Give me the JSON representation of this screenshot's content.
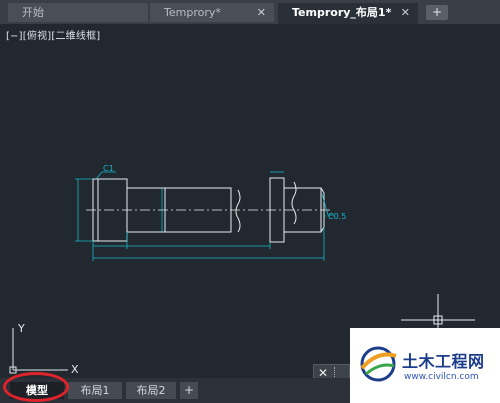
{
  "tabs": {
    "start_label": "开始",
    "tab1_label": "Temprory*",
    "tab2_label": "Temprory_布局1*",
    "close_glyph": "✕",
    "add_glyph": "+"
  },
  "viewport": {
    "label": "[−][俯视][二维线框]"
  },
  "drawing": {
    "dim_c1": "C1",
    "dim_c05": "C0.5"
  },
  "ucs": {
    "y_label": "Y",
    "x_label": "X"
  },
  "mini_panel": {
    "close_glyph": "✕"
  },
  "layout_tabs": {
    "model_label": "模型",
    "layout1_label": "布局1",
    "layout2_label": "布局2",
    "add_glyph": "+"
  },
  "watermark": {
    "title": "土木工程网",
    "url": "www.civilcn.com"
  },
  "colors": {
    "canvas": "#212830",
    "geometry": "#e9ecef",
    "dimension": "#18b7c8",
    "highlight": "#e0232b",
    "brand_blue": "#1c3c8c"
  }
}
